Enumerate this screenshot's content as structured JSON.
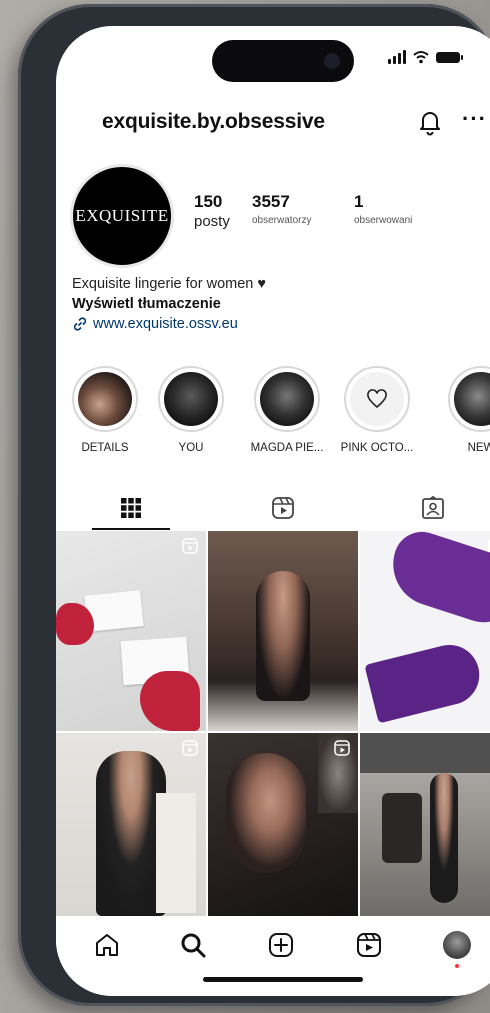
{
  "profile": {
    "username": "exquisite.by.obsessive",
    "avatar_text": "EXQUISITE",
    "stats": [
      {
        "value": "150",
        "label": "posty"
      },
      {
        "value": "3557",
        "label": "obserwatorzy"
      },
      {
        "value": "1",
        "label": "obserwowani"
      }
    ],
    "bio_line": "Exquisite lingerie for women ♥",
    "translate": "Wyświetl tłumaczenie",
    "link": "www.exquisite.ossv.eu"
  },
  "highlights": [
    {
      "label": "DETAILS"
    },
    {
      "label": "YOU"
    },
    {
      "label": "MAGDA PIE..."
    },
    {
      "label": "PINK OCTO..."
    },
    {
      "label": "NEW"
    }
  ],
  "icons": {
    "bell": "bell-icon",
    "more": "more-icon",
    "link": "link-icon",
    "grid_tab": "grid-icon",
    "reels_tab": "reels-icon",
    "tagged_tab": "tagged-icon",
    "nav": [
      "home-icon",
      "search-icon",
      "create-icon",
      "reels-icon",
      "profile-avatar"
    ]
  },
  "more_glyph": "···",
  "colors": {
    "link": "#00376b",
    "notification_dot": "#ff3040"
  }
}
